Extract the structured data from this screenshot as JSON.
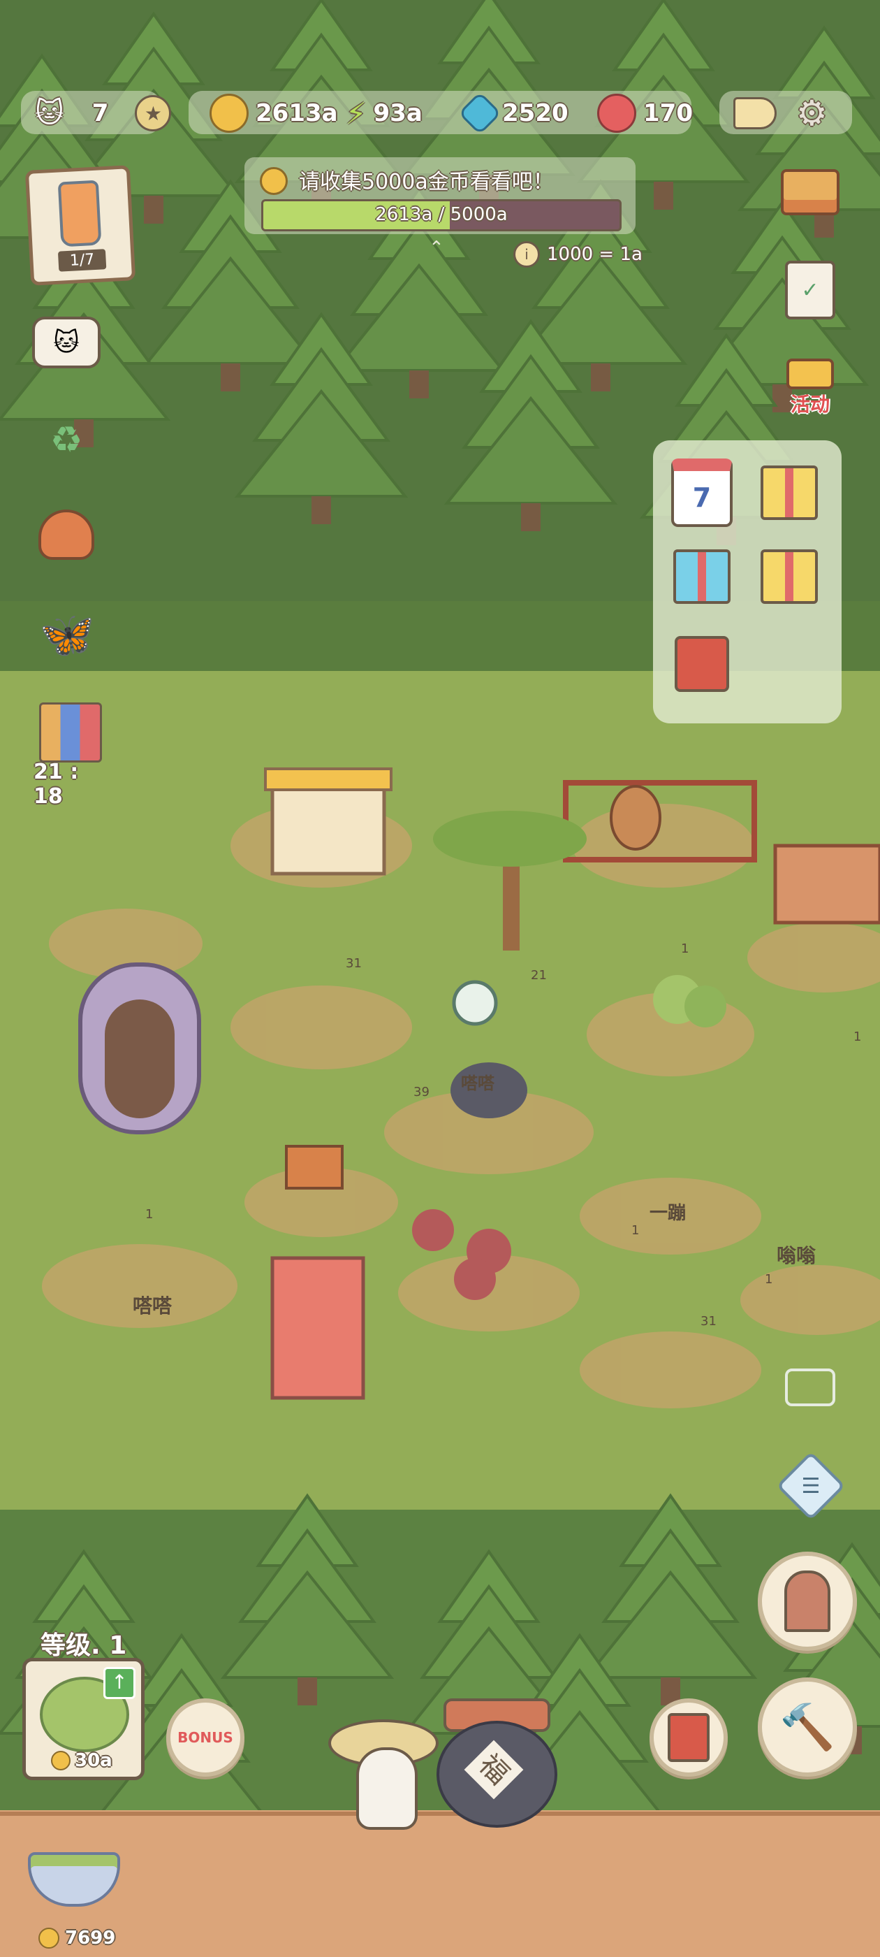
{
  "topbar": {
    "cats": "7",
    "coins": "2613a",
    "energy": "93a",
    "gems": "2520",
    "tickets": "170"
  },
  "quest": {
    "text": "请收集5000a金币看看吧！",
    "progress_label": "2613a / 5000a",
    "progress": 0.5226,
    "exchange_note": "1000 = 1a"
  },
  "bottle": {
    "count": "1/7"
  },
  "event": {
    "label": "活动",
    "calendar_day": "7"
  },
  "timer": {
    "text": "21 : 18"
  },
  "level": {
    "label": "等级. 1",
    "upgrade_cost": "30a"
  },
  "bonus": {
    "label": "BONUS"
  },
  "jar": {
    "label": "福"
  },
  "bottom": {
    "coins": "7699"
  },
  "world_signs": {
    "s31a": "31",
    "s21": "21",
    "s39": "39",
    "s1a": "1",
    "s1b": "1",
    "s1c": "1",
    "s31b": "31",
    "s1d": "1",
    "s1e": "1",
    "bubble1": "嗒嗒",
    "bubble2": "嗒嗒",
    "bubble3": "嗡嗡",
    "bubble4": "一蹦"
  },
  "colors": {
    "forest_dark": "#4b6b3c",
    "forest_mid": "#5f8444",
    "meadow": "#93ad57",
    "progress_fill": "#b8d96a",
    "progress_track": "#7a5960",
    "wood_floor": "#dba57a"
  }
}
